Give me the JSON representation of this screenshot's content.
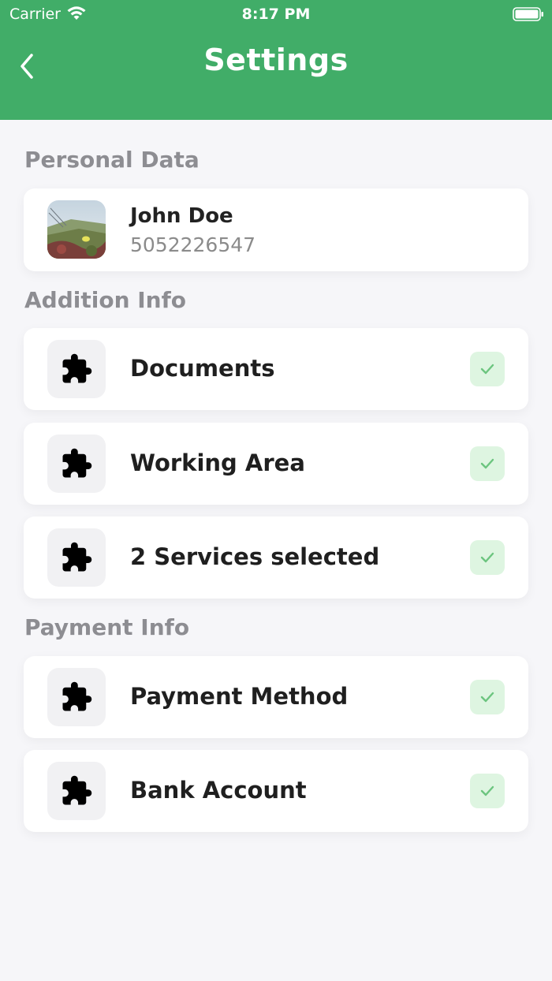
{
  "status_bar": {
    "carrier": "Carrier",
    "time": "8:17 PM"
  },
  "header": {
    "title": "Settings",
    "back_icon": "chevron-left-icon"
  },
  "sections": {
    "personal": "Personal Data",
    "addition": "Addition Info",
    "payment": "Payment Info"
  },
  "profile": {
    "name": "John Doe",
    "phone": "5052226547"
  },
  "addition_items": [
    {
      "label": "Documents",
      "icon": "puzzle-icon",
      "status": "completed"
    },
    {
      "label": "Working Area",
      "icon": "puzzle-icon",
      "status": "completed"
    },
    {
      "label": "2 Services selected",
      "icon": "puzzle-icon",
      "status": "completed"
    }
  ],
  "payment_items": [
    {
      "label": "Payment Method",
      "icon": "puzzle-icon",
      "status": "completed"
    },
    {
      "label": "Bank Account",
      "icon": "puzzle-icon",
      "status": "completed"
    }
  ],
  "colors": {
    "header": "#41ad68",
    "background": "#f6f6f9",
    "section_title": "#8d8d92",
    "check_bg": "#def5e1",
    "check_mark": "#6cc57f"
  }
}
